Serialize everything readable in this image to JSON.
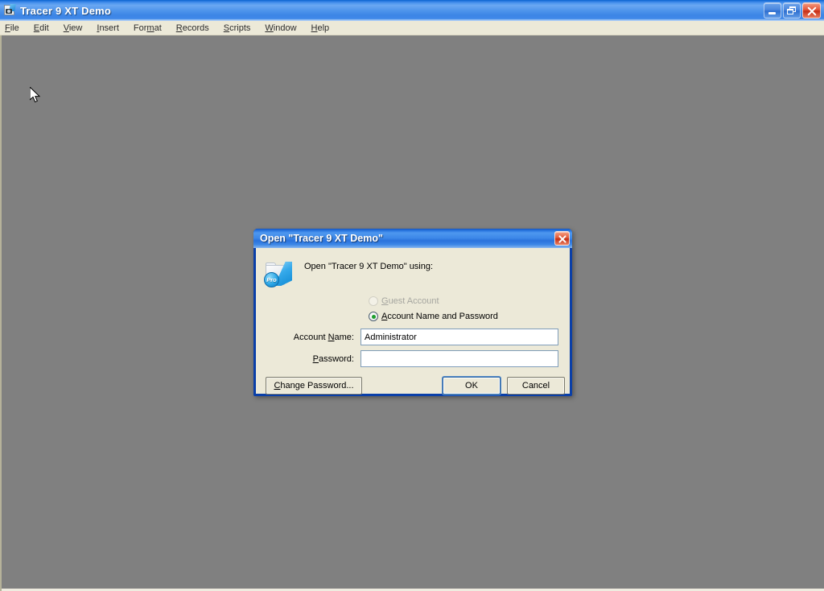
{
  "window": {
    "title": "Tracer 9 XT Demo",
    "app_icon": "filemaker-app-icon",
    "controls": {
      "minimize_label": "Minimize",
      "restore_label": "Restore",
      "close_label": "Close"
    }
  },
  "menu_bar": {
    "items": [
      {
        "label": "File",
        "accel": "F"
      },
      {
        "label": "Edit",
        "accel": "E"
      },
      {
        "label": "View",
        "accel": "V"
      },
      {
        "label": "Insert",
        "accel": "I"
      },
      {
        "label": "Format",
        "accel": "m"
      },
      {
        "label": "Records",
        "accel": "R"
      },
      {
        "label": "Scripts",
        "accel": "S"
      },
      {
        "label": "Window",
        "accel": "W"
      },
      {
        "label": "Help",
        "accel": "H"
      }
    ]
  },
  "dialog": {
    "title": "Open \"Tracer 9 XT Demo\"",
    "close_label": "Close",
    "icon": "filemaker-pro-folder-icon",
    "icon_badge": "Pro",
    "prompt": "Open \"Tracer 9 XT Demo\" using:",
    "options": [
      {
        "id": "guest",
        "label": "Guest Account",
        "selected": false,
        "disabled": true
      },
      {
        "id": "account",
        "label": "Account Name and Password",
        "selected": true,
        "disabled": false
      }
    ],
    "fields": {
      "account_name": {
        "label": "Account Name:",
        "value": "Administrator",
        "placeholder": ""
      },
      "password": {
        "label": "Password:",
        "value": "",
        "placeholder": ""
      }
    },
    "buttons": {
      "change_password": "Change Password...",
      "ok": "OK",
      "cancel": "Cancel"
    }
  },
  "colors": {
    "desktop": "#808080",
    "title_bar_blue": "#3d86e6",
    "dialog_border": "#0a3fa8",
    "dialog_face": "#ece9d8",
    "close_red": "#c62f17",
    "radio_selected_green": "#1d9e2d",
    "input_border": "#7f9db9",
    "default_button_focus": "#4d85c6"
  }
}
